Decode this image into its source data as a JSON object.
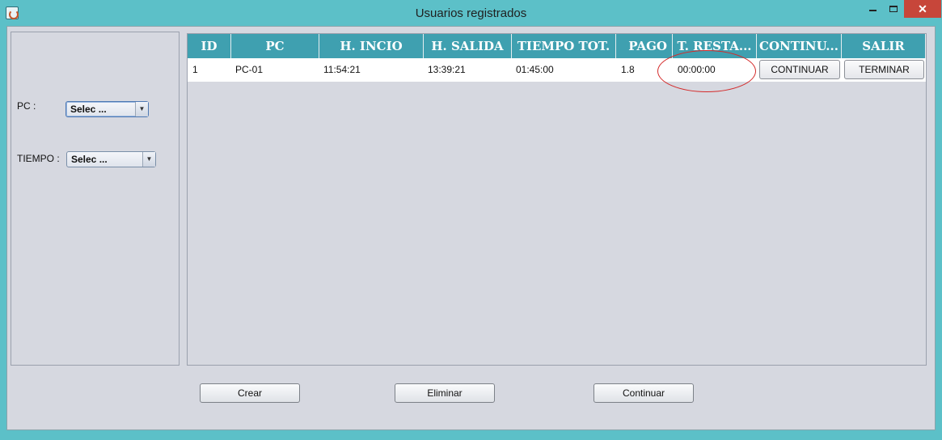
{
  "window": {
    "title": "Usuarios registrados",
    "app_icon": "java-cup-icon",
    "controls": {
      "minimize": "minimize-icon",
      "maximize": "maximize-icon",
      "close": "✕"
    }
  },
  "form": {
    "pc_label": "PC :",
    "pc_select_value": "Selec ...",
    "tiempo_label": "TIEMPO :",
    "tiempo_select_value": "Selec ..."
  },
  "table": {
    "columns": [
      "ID",
      "PC",
      "H. INCIO",
      "H. SALIDA",
      "TIEMPO TOT.",
      "PAGO",
      "T. RESTA...",
      "CONTINU...",
      "SALIR"
    ],
    "rows": [
      {
        "id": "1",
        "pc": "PC-01",
        "h_inicio": "11:54:21",
        "h_salida": "13:39:21",
        "tiempo_tot": "01:45:00",
        "pago": "1.8",
        "t_restante": "00:00:00",
        "continuar_btn": "CONTINUAR",
        "salir_btn": "TERMINAR"
      }
    ],
    "highlight_color": "#d42a2a",
    "header_color": "#3fa0b0"
  },
  "actions": {
    "crear": "Crear",
    "eliminar": "Eliminar",
    "continuar": "Continuar"
  }
}
